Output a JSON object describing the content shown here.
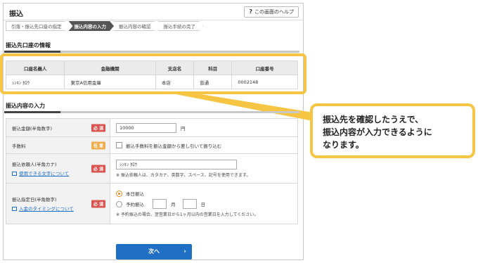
{
  "header": {
    "title": "振込",
    "help_label": "この画面のヘルプ",
    "help_symbol": "?"
  },
  "steps": [
    {
      "label": "引落・振込先口座の指定",
      "active": false
    },
    {
      "label": "振込内容の入力",
      "active": true
    },
    {
      "label": "振込内容の確認",
      "active": false
    },
    {
      "label": "振込手続の完了",
      "active": false
    }
  ],
  "account_section": {
    "title": "振込先口座の情報",
    "columns": [
      "口座名義人",
      "金融機関",
      "支店名",
      "科目",
      "口座番号"
    ],
    "row": [
      "ｼﾝｷﾝ ﾀﾛｳ",
      "東京A信用金庫",
      "本店",
      "普通",
      "0002148"
    ]
  },
  "form_section": {
    "title": "振込内容の入力",
    "amount": {
      "label": "振込金額(半角数字)",
      "badge": "必 須",
      "value": "10000",
      "unit": "円"
    },
    "fee": {
      "label": "手数料",
      "badge": "任 意",
      "checkbox_label": "振込手数料を振込金額から差し引いて振り込む"
    },
    "requester": {
      "label": "振込依頼人(半角カナ)",
      "badge": "必 須",
      "link": "使用できる文字について",
      "value": "ｼﾝｷﾝ ﾀﾛｳ",
      "note": "※ 振込依頼人は、カタカナ、英数字、スペース、記号を使用できます。"
    },
    "date": {
      "label": "振込指定日(半角数字)",
      "badge": "必 須",
      "link": "入金のタイミングについて",
      "option_today": "本日振込",
      "option_reserve": "予約振込",
      "month_unit": "月",
      "day_unit": "日",
      "note": "※ 予約振込の場合、翌営業日から1ヶ月以内の営業日を入力してください。"
    }
  },
  "next_button": {
    "label": "次へ",
    "chevron": "›"
  },
  "callout": {
    "line1": "振込先を確認したうえで、",
    "line2": "振込内容が入力できるように",
    "line3": "なります。"
  },
  "colors": {
    "highlight": "#f6c544",
    "button": "#1f6fc4",
    "required": "#d9534f",
    "optional": "#f0ad4e"
  }
}
